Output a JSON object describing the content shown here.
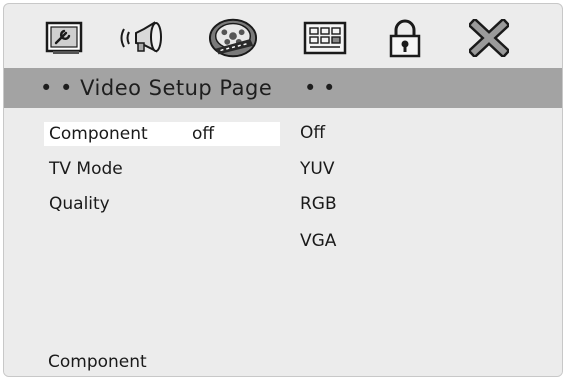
{
  "toolbar": {
    "icons": [
      {
        "name": "general-setup-icon"
      },
      {
        "name": "audio-setup-icon"
      },
      {
        "name": "video-setup-icon"
      },
      {
        "name": "preference-setup-icon"
      },
      {
        "name": "password-setup-icon"
      },
      {
        "name": "exit-setup-icon"
      }
    ],
    "active_index": 2
  },
  "title": {
    "text": "• • Video Setup Page",
    "trailing": "• •"
  },
  "menu": {
    "items": [
      {
        "label": "Component",
        "value": "off",
        "selected": true
      },
      {
        "label": "TV Mode",
        "value": ""
      },
      {
        "label": "Quality",
        "value": ""
      }
    ]
  },
  "options": {
    "items": [
      "Off",
      "YUV",
      "RGB",
      "VGA"
    ]
  },
  "status": {
    "text": "Component"
  },
  "colors": {
    "title_bar": "#a3a3a3",
    "panel": "#ececec",
    "selected_row": "#ffffff"
  }
}
